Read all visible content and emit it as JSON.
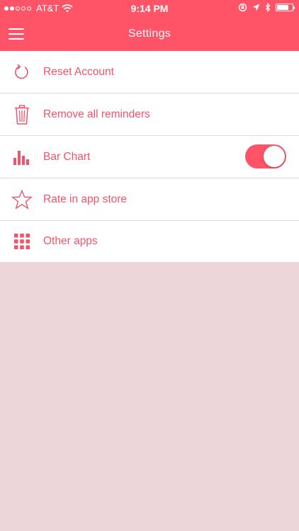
{
  "status_bar": {
    "carrier": "AT&T",
    "time": "9:14 PM",
    "signal_bars_filled": 2,
    "signal_bars_total": 5,
    "battery_level": 0.75
  },
  "header": {
    "title": "Settings",
    "menu_icon": "hamburger-icon"
  },
  "settings": {
    "items": [
      {
        "label": "Reset Account",
        "icon": "refresh-icon"
      },
      {
        "label": "Remove all reminders",
        "icon": "trash-icon"
      },
      {
        "label": "Bar Chart",
        "icon": "bar-chart-icon",
        "toggle_on": true
      },
      {
        "label": "Rate in app store",
        "icon": "star-icon"
      },
      {
        "label": "Other apps",
        "icon": "grid-icon"
      }
    ]
  },
  "colors": {
    "accent": "#ff5467",
    "label": "#f0546b",
    "background": "#ecd6d9"
  }
}
